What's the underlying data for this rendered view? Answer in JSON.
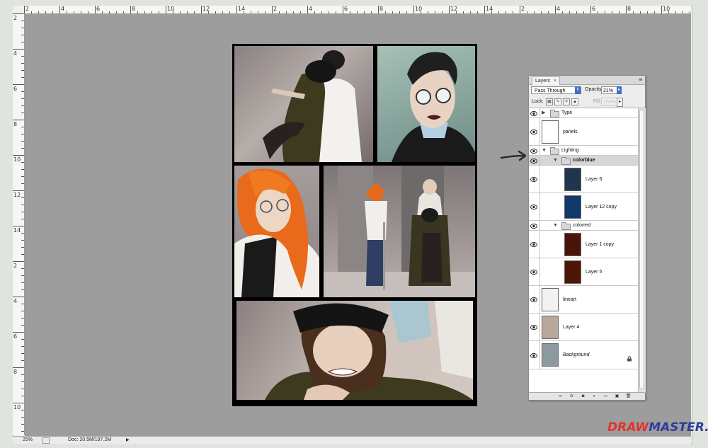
{
  "ruler": {
    "top_labels": [
      "2",
      "4",
      "6",
      "8",
      "10",
      "12",
      "14",
      "2",
      "4",
      "6",
      "8",
      "10",
      "12",
      "14",
      "2",
      "4",
      "6",
      "8",
      "10",
      "12"
    ],
    "left_labels": [
      "2",
      "4",
      "6",
      "8",
      "10",
      "12",
      "14",
      "2",
      "4",
      "6",
      "8",
      "10",
      "12",
      "14",
      "2",
      "4",
      "6",
      "8",
      "10",
      "12",
      "14",
      "2",
      "4",
      "6",
      "8",
      "10",
      "12",
      "14"
    ]
  },
  "status_bar": {
    "zoom": "25%",
    "doc_info": "Doc: 20.5M/197.2M"
  },
  "layers_panel": {
    "tab_label": "Layers",
    "tab_close": "×",
    "menu_icon": "panel-menu-icon",
    "blend_mode": "Pass Through",
    "opacity_label": "Opacity:",
    "opacity_value": "21%",
    "lock_label": "Lock:",
    "fill_label": "Fill:",
    "fill_value": "100%",
    "layers": [
      {
        "name": "Type",
        "kind": "group",
        "indent": 0,
        "expanded": false
      },
      {
        "name": "panels",
        "kind": "layer",
        "indent": 0,
        "thumb_color": "#ffffff"
      },
      {
        "name": "Lighting",
        "kind": "group",
        "indent": 0,
        "expanded": true
      },
      {
        "name": "colorblue",
        "kind": "group",
        "indent": 1,
        "expanded": true,
        "selected": true
      },
      {
        "name": "Layer 6",
        "kind": "layer",
        "indent": 2,
        "thumb_color": "#223550"
      },
      {
        "name": "Layer 12 copy",
        "kind": "layer",
        "indent": 2,
        "thumb_color": "#0f3a6b"
      },
      {
        "name": "colorred",
        "kind": "group",
        "indent": 1,
        "expanded": true
      },
      {
        "name": "Layer 1 copy",
        "kind": "layer",
        "indent": 2,
        "thumb_color": "#4a1508"
      },
      {
        "name": "Layer 5",
        "kind": "layer",
        "indent": 2,
        "thumb_color": "#4d1608"
      },
      {
        "name": "lineart",
        "kind": "layer",
        "indent": 0,
        "thumb_color": "#f2f2f2"
      },
      {
        "name": "Layer 4",
        "kind": "layer",
        "indent": 0,
        "thumb_color": "#b9a79c"
      },
      {
        "name": "Background",
        "kind": "layer",
        "indent": 0,
        "thumb_color": "#8a9a9e",
        "locked": true
      }
    ],
    "footer_buttons": [
      "link-layers-icon",
      "fx-icon",
      "mask-icon",
      "adjustment-layer-icon",
      "new-group-icon",
      "new-layer-icon",
      "trash-icon"
    ]
  },
  "watermark": {
    "part1": "DRAW",
    "part2": "MASTER.RU"
  },
  "colors": {
    "canvas_bg": "#9d9d9d",
    "accent_blue": "#3d6fc9",
    "selected_row": "#d6d6d6"
  }
}
